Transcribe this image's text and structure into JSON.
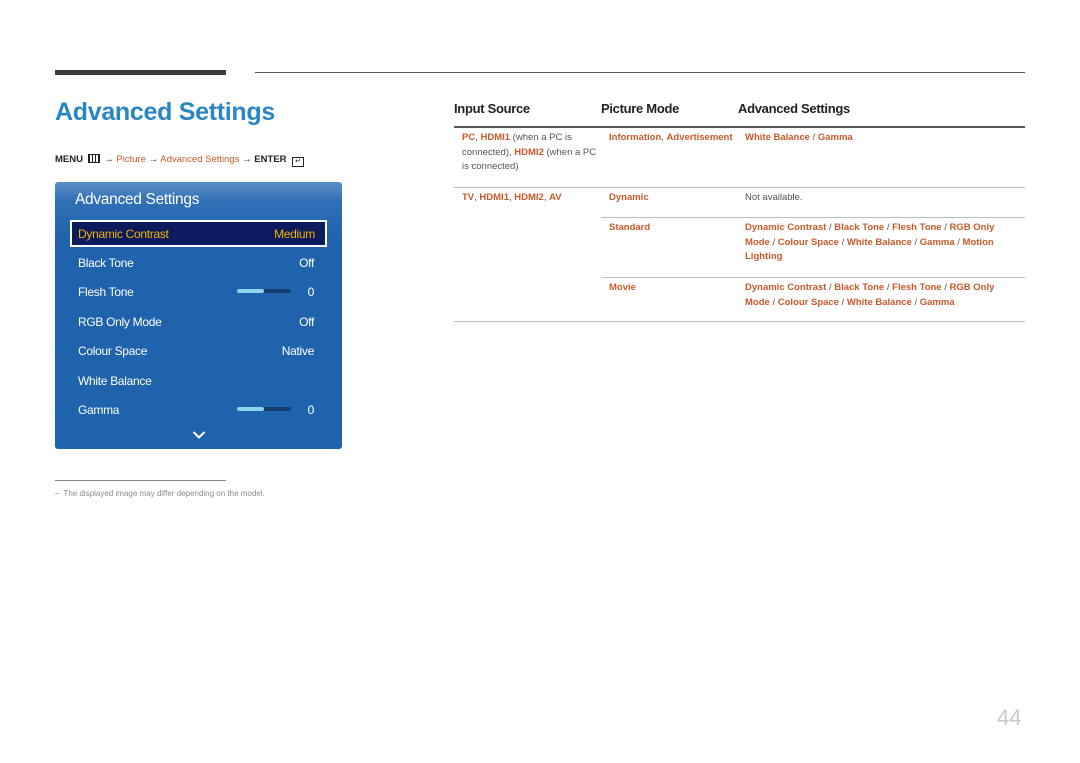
{
  "page": {
    "title": "Advanced Settings",
    "page_number": "44"
  },
  "breadcrumb": {
    "menu": "MENU",
    "menu_icon": "menu-icon",
    "arrow": "→",
    "picture": "Picture",
    "advanced": "Advanced Settings",
    "enter": "ENTER",
    "enter_icon": "enter-icon"
  },
  "osd": {
    "title": "Advanced Settings",
    "items": [
      {
        "label": "Dynamic Contrast",
        "value": "Medium",
        "selected": true
      },
      {
        "label": "Black Tone",
        "value": "Off"
      },
      {
        "label": "Flesh Tone",
        "value": "0",
        "slider": 0.5
      },
      {
        "label": "RGB Only Mode",
        "value": "Off"
      },
      {
        "label": "Colour Space",
        "value": "Native"
      },
      {
        "label": "White Balance",
        "value": ""
      },
      {
        "label": "Gamma",
        "value": "0",
        "slider": 0.5
      }
    ],
    "more_icon": "chevron-down-icon"
  },
  "footnote": {
    "dash": "–",
    "text": "The displayed image may differ depending on the model."
  },
  "table": {
    "headers": [
      "Input Source",
      "Picture Mode",
      "Advanced Settings"
    ],
    "rows": [
      {
        "input_parts": [
          {
            "t": "PC",
            "o": true
          },
          {
            "t": ", "
          },
          {
            "t": "HDMI1",
            "o": true
          },
          {
            "t": " (when a PC is connected), "
          },
          {
            "t": "HDMI2",
            "o": true
          },
          {
            "t": " (when a PC is connected)"
          }
        ],
        "mode_parts": [
          {
            "t": "Information",
            "o": true
          },
          {
            "t": ", "
          },
          {
            "t": "Advertisement",
            "o": true
          }
        ],
        "settings_parts": [
          {
            "t": "White Balance",
            "o": true
          },
          {
            "t": " / "
          },
          {
            "t": "Gamma",
            "o": true
          }
        ]
      },
      {
        "input_parts": [
          {
            "t": "TV",
            "o": true
          },
          {
            "t": ", "
          },
          {
            "t": "HDMI1",
            "o": true
          },
          {
            "t": ", "
          },
          {
            "t": "HDMI2",
            "o": true
          },
          {
            "t": ", "
          },
          {
            "t": "AV",
            "o": true
          }
        ],
        "mode_parts": [
          {
            "t": "Dynamic",
            "o": true
          }
        ],
        "settings_parts": [
          {
            "t": "Not available."
          }
        ]
      },
      {
        "input_parts": [],
        "mode_parts": [
          {
            "t": "Standard",
            "o": true
          }
        ],
        "settings_parts": [
          {
            "t": "Dynamic Contrast",
            "o": true
          },
          {
            "t": " / "
          },
          {
            "t": "Black Tone",
            "o": true
          },
          {
            "t": " / "
          },
          {
            "t": "Flesh Tone",
            "o": true
          },
          {
            "t": " / "
          },
          {
            "t": "RGB Only Mode",
            "o": true
          },
          {
            "t": " / "
          },
          {
            "t": "Colour Space",
            "o": true
          },
          {
            "t": " / "
          },
          {
            "t": "White Balance",
            "o": true
          },
          {
            "t": " / "
          },
          {
            "t": "Gamma",
            "o": true
          },
          {
            "t": " / "
          },
          {
            "t": "Motion Lighting",
            "o": true
          }
        ]
      },
      {
        "input_parts": [],
        "mode_parts": [
          {
            "t": "Movie",
            "o": true
          }
        ],
        "settings_parts": [
          {
            "t": "Dynamic Contrast",
            "o": true
          },
          {
            "t": " / "
          },
          {
            "t": "Black Tone",
            "o": true
          },
          {
            "t": " / "
          },
          {
            "t": "Flesh Tone",
            "o": true
          },
          {
            "t": " / "
          },
          {
            "t": "RGB Only Mode",
            "o": true
          },
          {
            "t": " / "
          },
          {
            "t": "Colour Space",
            "o": true
          },
          {
            "t": " / "
          },
          {
            "t": "White Balance",
            "o": true
          },
          {
            "t": " / "
          },
          {
            "t": "Gamma",
            "o": true
          }
        ]
      }
    ]
  },
  "colors": {
    "title_blue": "#2a85c5",
    "accent_orange": "#c85a28",
    "osd_blue": "#1f63ac",
    "osd_selected_bg": "#0c1a5e",
    "osd_selected_text": "#f0b400",
    "slider_fill": "#8ed3ea"
  }
}
